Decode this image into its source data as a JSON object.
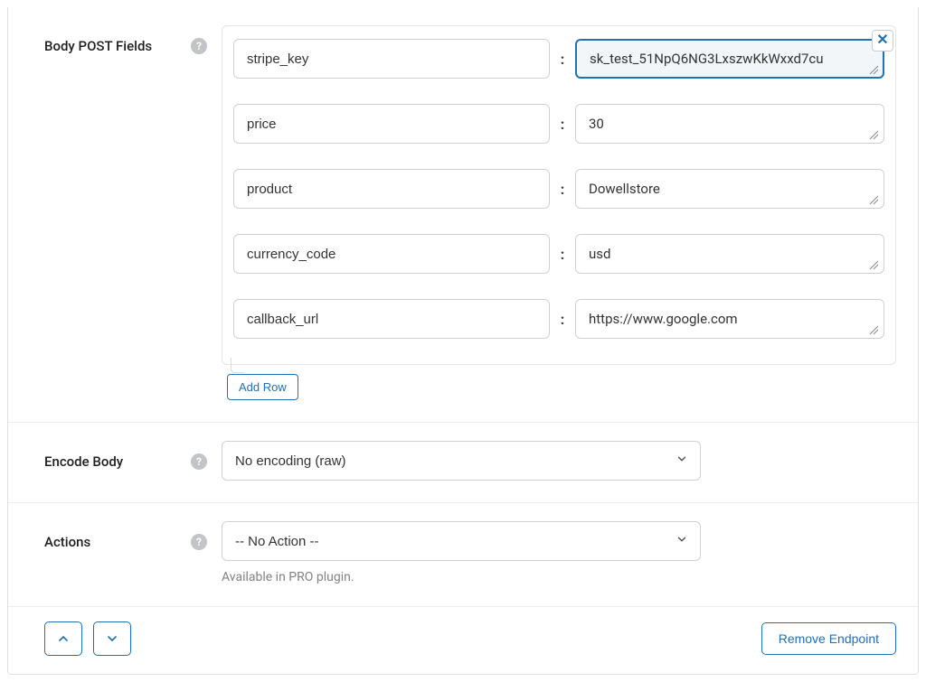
{
  "sections": {
    "body_post": {
      "label": "Body POST Fields",
      "rows": [
        {
          "key": "stripe_key",
          "value": "sk_test_51NpQ6NG3LxszwKkWxxd7cu",
          "focused": true
        },
        {
          "key": "price",
          "value": "30",
          "focused": false
        },
        {
          "key": "product",
          "value": "Dowellstore",
          "focused": false
        },
        {
          "key": "currency_code",
          "value": "usd",
          "focused": false
        },
        {
          "key": "callback_url",
          "value": "https://www.google.com",
          "focused": false
        }
      ],
      "add_row_label": "Add Row"
    },
    "encode_body": {
      "label": "Encode Body",
      "selected": "No encoding (raw)"
    },
    "actions": {
      "label": "Actions",
      "selected": "-- No Action --",
      "hint": "Available in PRO plugin."
    }
  },
  "footer": {
    "remove_endpoint_label": "Remove Endpoint"
  },
  "icons": {
    "help": "?",
    "close": "✕"
  }
}
